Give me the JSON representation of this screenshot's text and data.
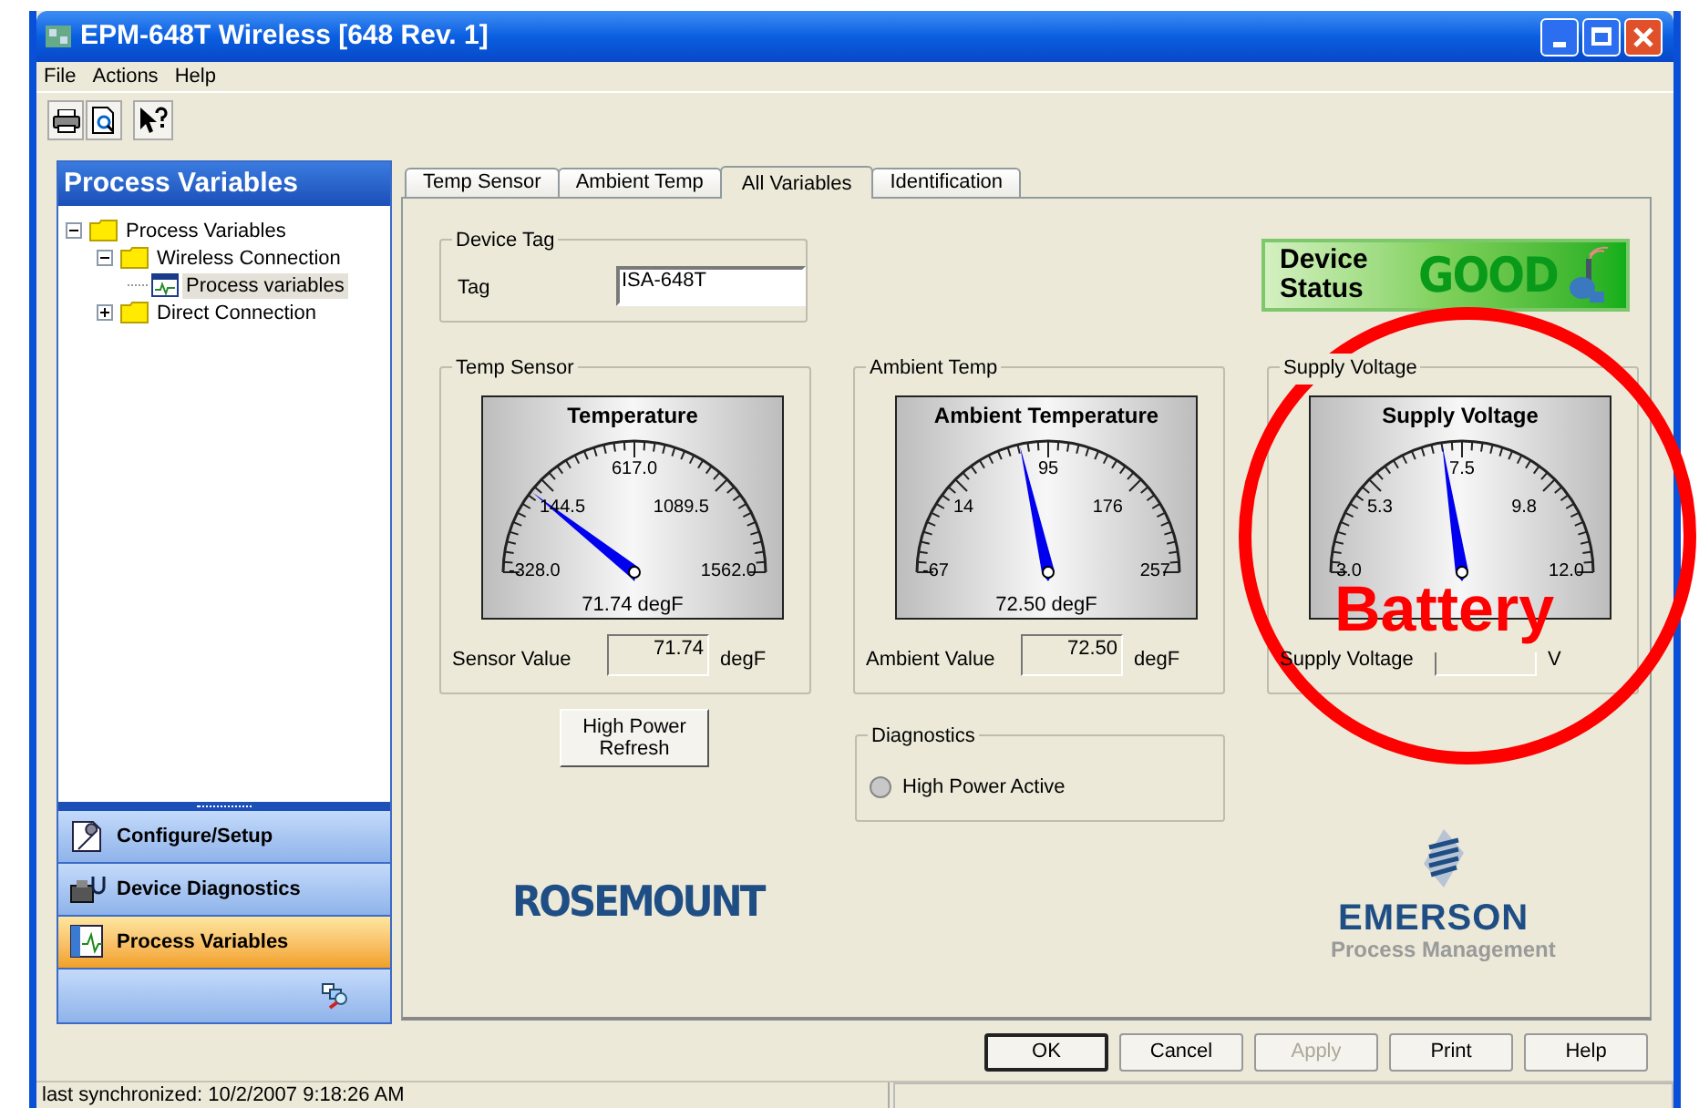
{
  "window": {
    "title": "EPM-648T Wireless [648 Rev. 1]"
  },
  "menu": [
    "File",
    "Actions",
    "Help"
  ],
  "sidebar": {
    "title": "Process Variables",
    "tree": [
      {
        "label": "Process Variables",
        "expanded": true,
        "selected": false,
        "children": [
          {
            "label": "Wireless Connection",
            "expanded": true,
            "selected": false,
            "children": [
              {
                "label": "Process variables",
                "selected": true,
                "kind": "page"
              }
            ]
          },
          {
            "label": "Direct Connection",
            "expanded": false,
            "selected": false
          }
        ]
      }
    ],
    "nav": [
      {
        "label": "Configure/Setup",
        "selected": false
      },
      {
        "label": "Device Diagnostics",
        "selected": false
      },
      {
        "label": "Process Variables",
        "selected": true
      }
    ]
  },
  "tabs": [
    {
      "label": "Temp Sensor",
      "selected": false
    },
    {
      "label": "Ambient Temp",
      "selected": false
    },
    {
      "label": "All Variables",
      "selected": true
    },
    {
      "label": "Identification",
      "selected": false
    }
  ],
  "device_tag": {
    "group": "Device Tag",
    "label": "Tag",
    "value": "ISA-648T"
  },
  "device_status": {
    "label": "Device Status",
    "value": "GOOD"
  },
  "gauges": [
    {
      "group": "Temp Sensor",
      "title": "Temperature",
      "ticks": [
        "-328.0",
        "144.5",
        "617.0",
        "1089.5",
        "1562.0"
      ],
      "level": 0.2115,
      "reading": "71.74 degF",
      "field_label": "Sensor Value",
      "field_value": "71.74",
      "unit": "degF"
    },
    {
      "group": "Ambient Temp",
      "title": "Ambient Temperature",
      "ticks": [
        "-67",
        "14",
        "95",
        "176",
        "257"
      ],
      "level": 0.43,
      "reading": "72.50 degF",
      "field_label": "Ambient Value",
      "field_value": "72.50",
      "unit": "degF"
    },
    {
      "group": "Supply Voltage",
      "title": "Supply Voltage",
      "ticks": [
        "3.0",
        "5.3",
        "7.5",
        "9.8",
        "12.0"
      ],
      "level": 0.451,
      "field_label": "Supply Voltage",
      "unit": "V"
    }
  ],
  "refresh_button": "High Power Refresh",
  "diagnostics": {
    "group": "Diagnostics",
    "items": [
      {
        "label": "High Power Active",
        "on": false
      }
    ]
  },
  "logos": {
    "rosemount": "ROSEMOUNT",
    "emerson": "EMERSON",
    "emerson_sub": "Process Management"
  },
  "buttons": [
    {
      "label": "OK",
      "default": true,
      "disabled": false
    },
    {
      "label": "Cancel",
      "default": false,
      "disabled": false
    },
    {
      "label": "Apply",
      "default": false,
      "disabled": true
    },
    {
      "label": "Print",
      "default": false,
      "disabled": false
    },
    {
      "label": "Help",
      "default": false,
      "disabled": false
    }
  ],
  "status_bar": "last synchronized: 10/2/2007 9:18:26 AM",
  "annotation": {
    "text": "Battery"
  }
}
